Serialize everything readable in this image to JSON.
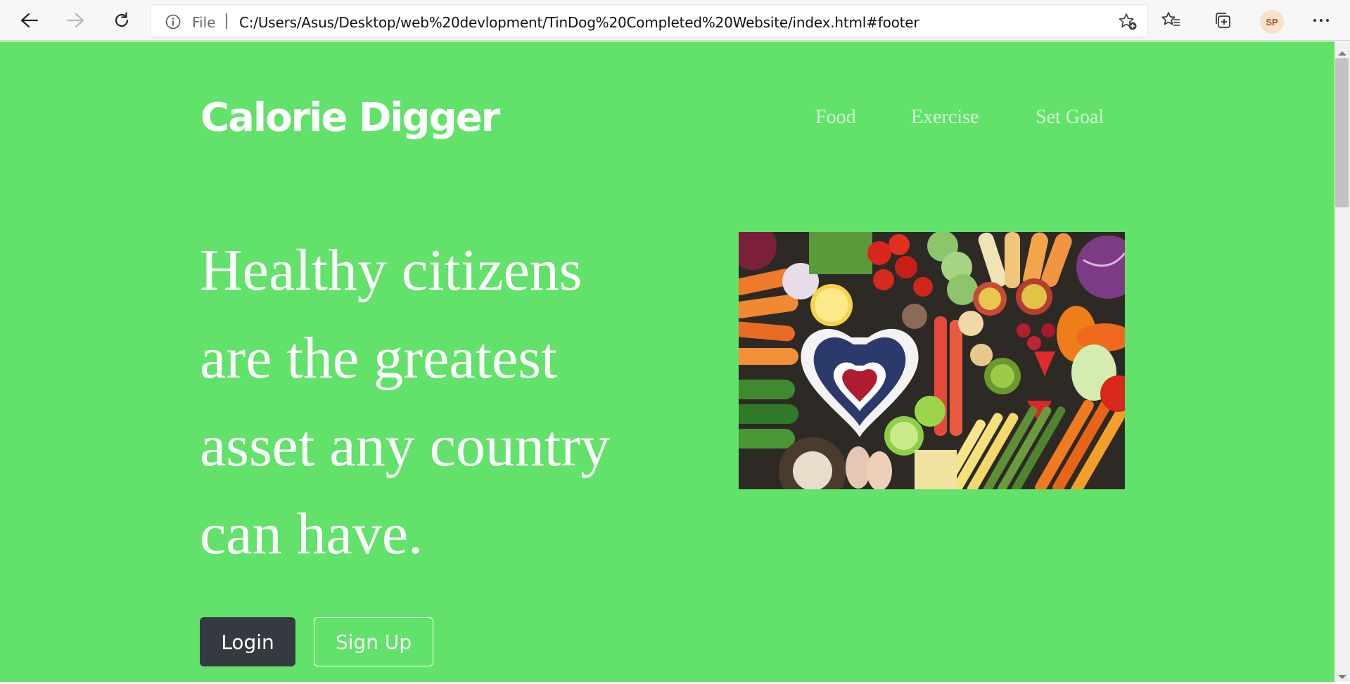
{
  "browser": {
    "scheme_label": "File",
    "url": "C:/Users/Asus/Desktop/web%20devlopment/TinDog%20Completed%20Website/index.html#footer",
    "profile_initials": "SP",
    "icons": [
      "back-arrow-icon",
      "forward-arrow-icon",
      "refresh-icon",
      "info-icon",
      "add-favorite-icon",
      "favorites-icon",
      "collections-icon",
      "more-icon"
    ]
  },
  "nav": {
    "brand": "Calorie Digger",
    "links": [
      "Food",
      "Exercise",
      "Set Goal"
    ]
  },
  "hero": {
    "headline": "Healthy citizens are the greatest asset any country can have.",
    "login_label": "Login",
    "signup_label": "Sign Up",
    "image_subject": "assorted vegetables and fruits with heart-shaped bowl"
  },
  "colors": {
    "page_bg": "#62e26a",
    "login_bg": "#343a40",
    "text": "#ffffff"
  }
}
